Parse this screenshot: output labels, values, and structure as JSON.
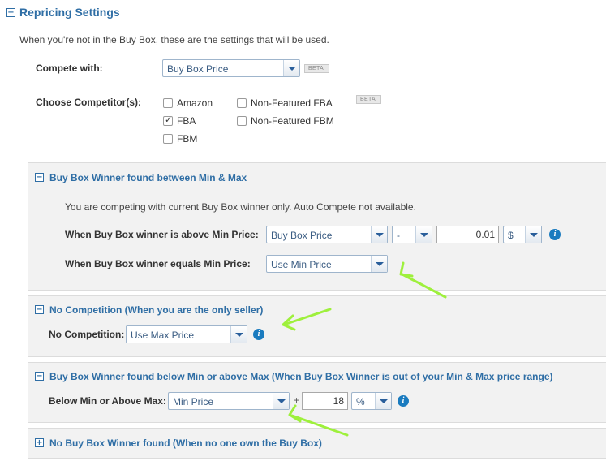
{
  "header": {
    "title": "Repricing Settings",
    "description": "When you're not in the Buy Box, these are the settings that will be used."
  },
  "compete": {
    "label": "Compete with:",
    "value": "Buy Box Price",
    "beta": "BETA"
  },
  "competitors": {
    "label": "Choose Competitor(s):",
    "beta": "BETA",
    "options": [
      {
        "label": "Amazon",
        "checked": false
      },
      {
        "label": "FBA",
        "checked": true
      },
      {
        "label": "FBM",
        "checked": false
      },
      {
        "label": "Non-Featured FBA",
        "checked": false
      },
      {
        "label": "Non-Featured FBM",
        "checked": false
      }
    ]
  },
  "section_between": {
    "title": "Buy Box Winner found between Min & Max",
    "note": "You are competing with current Buy Box winner only. Auto Compete not available.",
    "above_label": "When Buy Box winner is above Min Price:",
    "above_select": "Buy Box Price",
    "operator": "-",
    "amount": "0.01",
    "unit": "$",
    "equals_label": "When Buy Box winner equals Min Price:",
    "equals_select": "Use Min Price"
  },
  "section_nocomp": {
    "title": "No Competition (When you are the only seller)",
    "label": "No Competition:",
    "select": "Use Max Price"
  },
  "section_outside": {
    "title": "Buy Box Winner found below Min or above Max (When Buy Box Winner is out of your Min & Max price range)",
    "label": "Below Min or Above Max:",
    "select": "Min Price",
    "plus": "+",
    "amount": "18",
    "unit": "%"
  },
  "section_none": {
    "title": "No Buy Box Winner found (When no one own the Buy Box)"
  },
  "toggles": {
    "minus": "−",
    "plus": "+"
  },
  "info_glyph": "i",
  "colors": {
    "accent": "#2f6ea5",
    "arrow": "#9ef03c",
    "panel_bg": "#f2f2f2",
    "info": "#1a7bbf"
  }
}
